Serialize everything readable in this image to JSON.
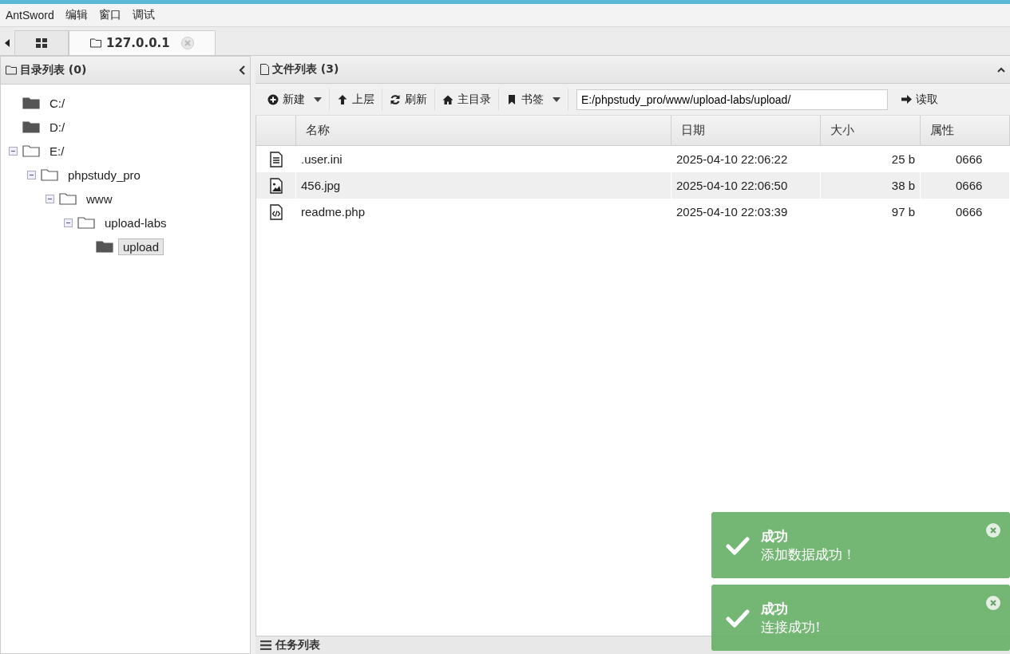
{
  "menu": [
    "AntSword",
    "编辑",
    "窗口",
    "调试"
  ],
  "tabs": [
    {
      "kind": "home",
      "selected": false
    },
    {
      "kind": "host",
      "label": "127.0.0.1",
      "selected": true
    }
  ],
  "dir_panel": {
    "title": "目录列表 (0)",
    "tree": [
      {
        "label": "C:/",
        "expanded": false,
        "selected": false
      },
      {
        "label": "D:/",
        "expanded": false,
        "selected": false
      },
      {
        "label": "E:/",
        "expanded": true,
        "selected": false,
        "children": [
          {
            "label": "phpstudy_pro",
            "expanded": true,
            "selected": false,
            "children": [
              {
                "label": "www",
                "expanded": true,
                "selected": false,
                "children": [
                  {
                    "label": "upload-labs",
                    "expanded": true,
                    "selected": false,
                    "children": [
                      {
                        "label": "upload",
                        "expanded": false,
                        "selected": true
                      }
                    ]
                  }
                ]
              }
            ]
          }
        ]
      }
    ]
  },
  "file_panel": {
    "title": "文件列表 (3)",
    "toolbar": [
      {
        "kind": "new",
        "label": "新建",
        "dropdown": true
      },
      {
        "kind": "up",
        "label": "上层",
        "dropdown": false
      },
      {
        "kind": "refresh",
        "label": "刷新",
        "dropdown": false
      },
      {
        "kind": "home",
        "label": "主目录",
        "dropdown": false
      },
      {
        "kind": "bookmark",
        "label": "书签",
        "dropdown": true
      }
    ],
    "path": "E:/phpstudy_pro/www/upload-labs/upload/",
    "read_button": "读取",
    "columns": [
      "名称",
      "日期",
      "大小",
      "属性"
    ],
    "rows": [
      {
        "kind": "text",
        "name": ".user.ini",
        "date": "2025-04-10 22:06:22",
        "size": "25 b",
        "mode": "0666",
        "selected": false
      },
      {
        "kind": "image",
        "name": "456.jpg",
        "date": "2025-04-10 22:06:50",
        "size": "38 b",
        "mode": "0666",
        "selected": true
      },
      {
        "kind": "code",
        "name": "readme.php",
        "date": "2025-04-10 22:03:39",
        "size": "97 b",
        "mode": "0666",
        "selected": false
      }
    ]
  },
  "task_panel": {
    "title": "任务列表"
  },
  "toasts": [
    {
      "title": "成功",
      "message": "添加数据成功！"
    },
    {
      "title": "成功",
      "message": "连接成功!"
    }
  ]
}
